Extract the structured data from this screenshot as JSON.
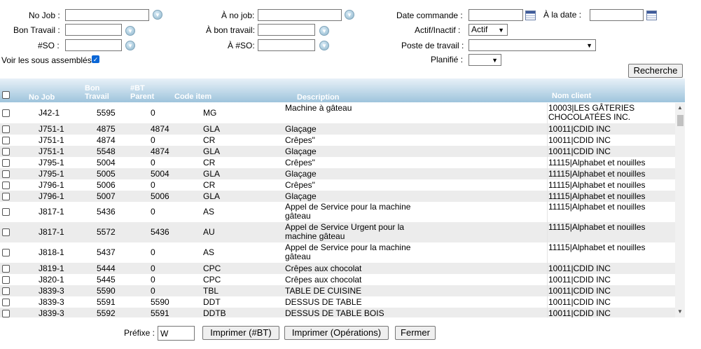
{
  "filters": {
    "no_job_label": "No Job  :",
    "a_no_job_label": "À no job:",
    "date_commande_label": "Date commande  :",
    "a_la_date_label": "À la date  :",
    "bon_travail_label": "Bon Travail  :",
    "a_bon_travail_label": "À bon travail:",
    "actif_inactif_label": "Actif/Inactif  :",
    "actif_value": "Actif",
    "so_label": "#SO  :",
    "a_so_label": "À #SO:",
    "poste_label": "Poste de travail  :",
    "voir_label": "Voir les sous assemblés",
    "planifie_label": "Planifié  :",
    "search_button": "Recherche"
  },
  "columns": {
    "no_job": "No Job",
    "bon_travail_1": "Bon",
    "bon_travail_2": "Travail",
    "bt_parent_1": "#BT",
    "bt_parent_2": "Parent",
    "code_item": "Code item",
    "description": "Description",
    "nom_client": "Nom client"
  },
  "rows": [
    {
      "job": "J42-1",
      "bt": "5595",
      "parent": "0",
      "code": "MG",
      "desc": "Machine à gâteau",
      "client": "10003|LES GÂTERIES CHOCOLATÉES INC."
    },
    {
      "job": "J751-1",
      "bt": "4875",
      "parent": "4874",
      "code": "GLA",
      "desc": "Glaçage",
      "client": "10011|CDID INC"
    },
    {
      "job": "J751-1",
      "bt": "4874",
      "parent": "0",
      "code": "CR",
      "desc": "Crêpes\"",
      "client": "10011|CDID INC"
    },
    {
      "job": "J751-1",
      "bt": "5548",
      "parent": "4874",
      "code": "GLA",
      "desc": "Glaçage",
      "client": "10011|CDID INC"
    },
    {
      "job": "J795-1",
      "bt": "5004",
      "parent": "0",
      "code": "CR",
      "desc": "Crêpes\"",
      "client": "11115|Alphabet et nouilles"
    },
    {
      "job": "J795-1",
      "bt": "5005",
      "parent": "5004",
      "code": "GLA",
      "desc": "Glaçage",
      "client": "11115|Alphabet et nouilles"
    },
    {
      "job": "J796-1",
      "bt": "5006",
      "parent": "0",
      "code": "CR",
      "desc": "Crêpes\"",
      "client": "11115|Alphabet et nouilles"
    },
    {
      "job": "J796-1",
      "bt": "5007",
      "parent": "5006",
      "code": "GLA",
      "desc": "Glaçage",
      "client": "11115|Alphabet et nouilles"
    },
    {
      "job": "J817-1",
      "bt": "5436",
      "parent": "0",
      "code": "AS",
      "desc": "Appel de Service pour la machine gâteau",
      "client": "11115|Alphabet et nouilles"
    },
    {
      "job": "J817-1",
      "bt": "5572",
      "parent": "5436",
      "code": "AU",
      "desc": "Appel de Service Urgent pour la machine gâteau",
      "client": "11115|Alphabet et nouilles"
    },
    {
      "job": "J818-1",
      "bt": "5437",
      "parent": "0",
      "code": "AS",
      "desc": "Appel de Service pour la machine gâteau",
      "client": "11115|Alphabet et nouilles"
    },
    {
      "job": "J819-1",
      "bt": "5444",
      "parent": "0",
      "code": "CPC",
      "desc": "Crêpes aux chocolat",
      "client": "10011|CDID INC"
    },
    {
      "job": "J820-1",
      "bt": "5445",
      "parent": "0",
      "code": "CPC",
      "desc": "Crêpes aux chocolat",
      "client": "10011|CDID INC"
    },
    {
      "job": "J839-3",
      "bt": "5590",
      "parent": "0",
      "code": "TBL",
      "desc": "TABLE DE CUISINE",
      "client": "10011|CDID INC"
    },
    {
      "job": "J839-3",
      "bt": "5591",
      "parent": "5590",
      "code": "DDT",
      "desc": "DESSUS DE TABLE",
      "client": "10011|CDID INC"
    },
    {
      "job": "J839-3",
      "bt": "5592",
      "parent": "5591",
      "code": "DDTB",
      "desc": "DESSUS DE TABLE BOIS",
      "client": "10011|CDID INC"
    }
  ],
  "footer": {
    "prefixe_label": "Préfixe :",
    "prefixe_value": "W",
    "print_bt": "Imprimer  (#BT)",
    "print_ops": "Imprimer  (Opérations)",
    "close": "Fermer"
  },
  "colors": {
    "header_top": "#e8f1f8",
    "header_bottom": "#9ec4dc",
    "row_alt": "#ececec"
  }
}
